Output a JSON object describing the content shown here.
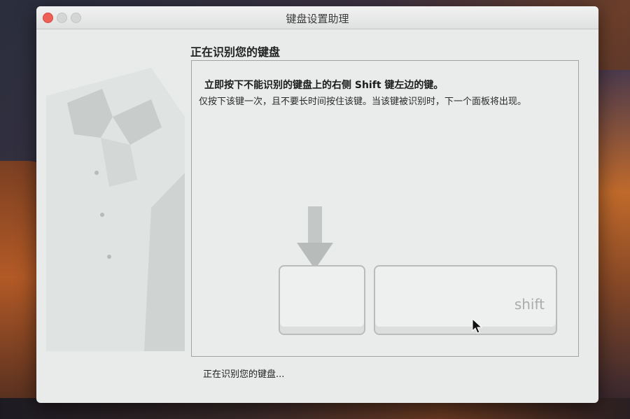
{
  "window": {
    "title": "键盘设置助理",
    "close_icon": "close-icon",
    "minimize_icon": "minimize-icon",
    "zoom_icon": "zoom-icon"
  },
  "main": {
    "heading": "正在识别您的键盘",
    "instruction": "立即按下不能识别的键盘上的右侧 Shift 键左边的键。",
    "detail": "仅按下该键一次，且不要长时间按住该键。当该键被识别时，下一个面板将出现。",
    "key_label": "shift",
    "status": "正在识别您的键盘..."
  },
  "colors": {
    "close": "#ee5f56",
    "panel_border": "#9fa3a2",
    "window_bg": "#e8ebea"
  },
  "icons": {
    "arrow": "down-arrow-icon",
    "cursor": "mouse-pointer-icon",
    "illustration": "butler-illustration"
  }
}
